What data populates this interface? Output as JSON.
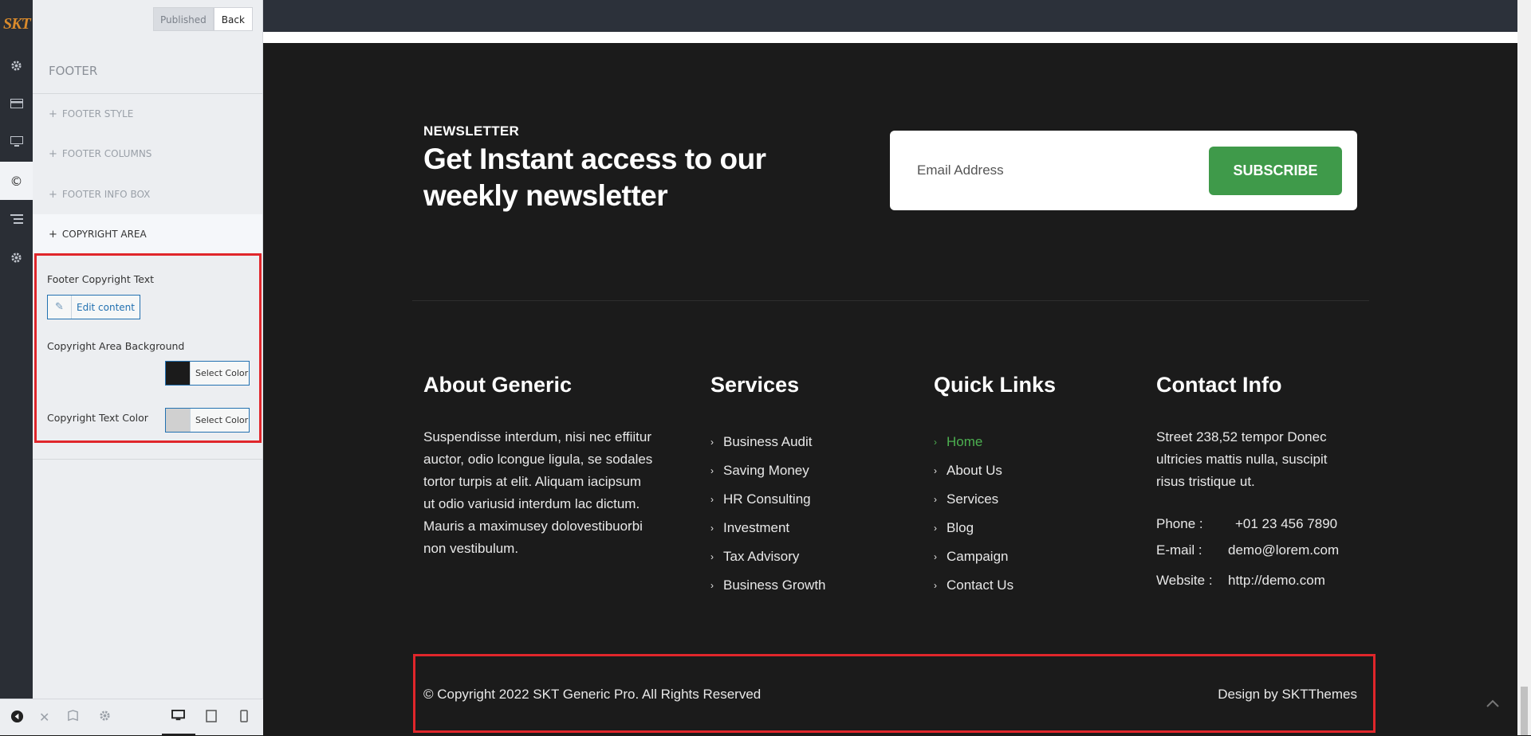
{
  "app": {
    "logo_text": "SKT"
  },
  "iconbar": {
    "items": [
      {
        "icon": "gear-icon"
      },
      {
        "icon": "card-icon"
      },
      {
        "icon": "monitor-icon"
      },
      {
        "icon": "copyright-icon",
        "label": "©"
      },
      {
        "icon": "list-icon"
      },
      {
        "icon": "gear-icon"
      }
    ]
  },
  "panel": {
    "published_label": "Published",
    "back_label": "Back",
    "section_title": "FOOTER",
    "accordions": [
      {
        "label": "FOOTER STYLE",
        "plus": "+"
      },
      {
        "label": "FOOTER COLUMNS",
        "plus": "+"
      },
      {
        "label": "FOOTER INFO BOX",
        "plus": "+"
      },
      {
        "label": "COPYRIGHT AREA",
        "plus": "+"
      }
    ],
    "copyright_text_label": "Footer Copyright Text",
    "edit_content_label": "Edit content",
    "bg_label": "Copyright Area Background",
    "bg_color": "#1b1b1b",
    "select_color_label": "Select Color",
    "text_color_label": "Copyright Text Color",
    "text_color": "#d0d0d0"
  },
  "newsletter": {
    "label": "NEWSLETTER",
    "title": "Get Instant access to our weekly newsletter",
    "email_placeholder": "Email Address",
    "subscribe_label": "SUBSCRIBE"
  },
  "about": {
    "heading": "About Generic",
    "text": "Suspendisse interdum, nisi nec effiitur auctor, odio lcongue ligula, se sodales tortor turpis at elit. Aliquam iacipsum ut odio variusid interdum lac dictum. Mauris a maximusey dolovestibuorbi non vestibulum."
  },
  "services": {
    "heading": "Services",
    "items": [
      "Business Audit",
      "Saving Money",
      "HR Consulting",
      "Investment",
      "Tax Advisory",
      "Business Growth"
    ]
  },
  "quick_links": {
    "heading": "Quick Links",
    "items": [
      "Home",
      "About Us",
      "Services",
      "Blog",
      "Campaign",
      "Contact Us"
    ]
  },
  "contact": {
    "heading": "Contact Info",
    "address": "Street 238,52 tempor Donec ultricies mattis nulla, suscipit risus tristique ut.",
    "phone_label": "Phone :",
    "phone_value": "+01 23 456 7890",
    "email_label": "E-mail :",
    "email_value": "demo@lorem.com",
    "website_label": "Website :",
    "website_value": "http://demo.com"
  },
  "copyright": {
    "left": "© Copyright 2022 SKT Generic Pro. All Rights Reserved",
    "right": "Design by SKTThemes"
  },
  "colors": {
    "accent_green": "#3f9a4a",
    "highlight_red": "#e0262b",
    "wp_blue": "#2271b1"
  }
}
